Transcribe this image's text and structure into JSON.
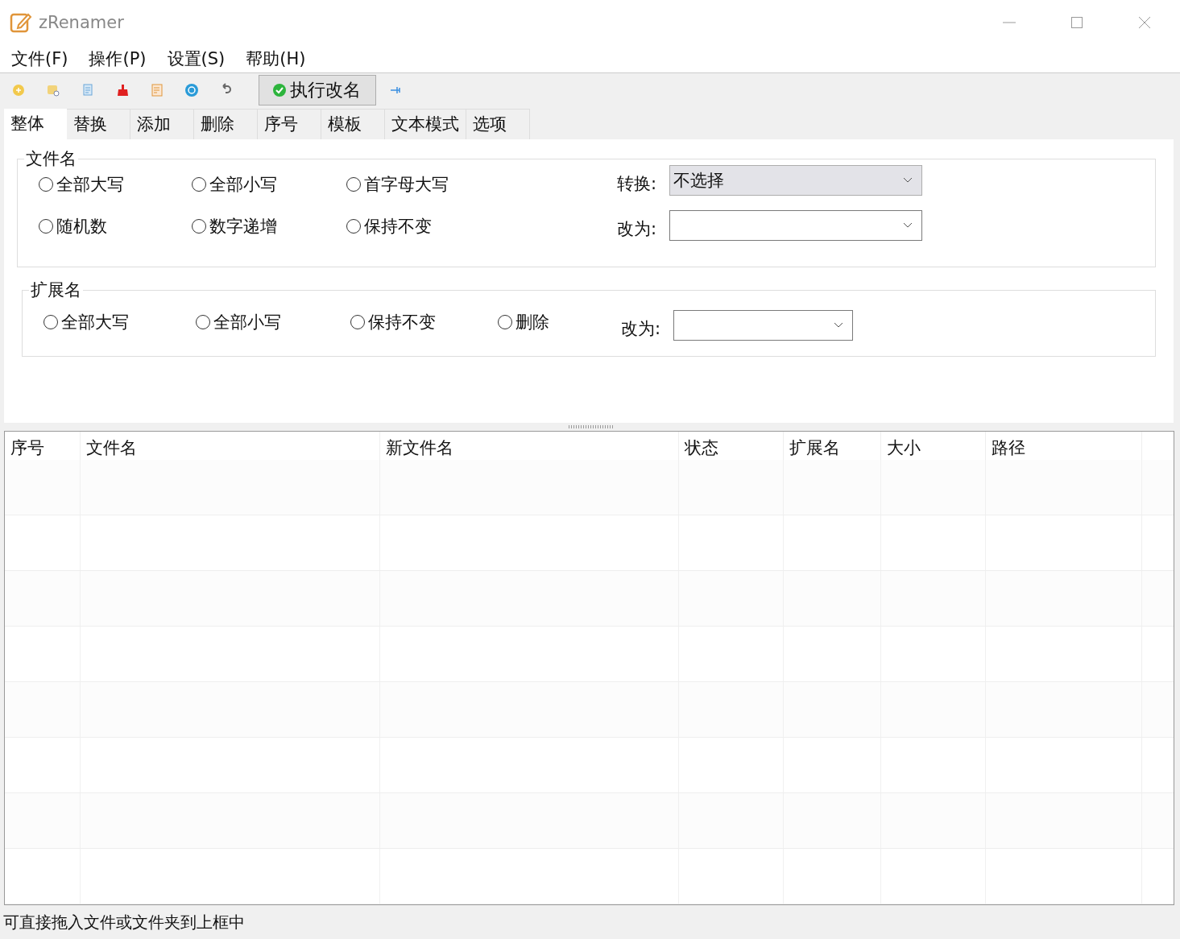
{
  "window": {
    "title": "zRenamer"
  },
  "menu": [
    "文件(F)",
    "操作(P)",
    "设置(S)",
    "帮助(H)"
  ],
  "toolbar": {
    "run_button": "执行改名"
  },
  "tabs": [
    {
      "label": "整体",
      "selected": true
    },
    {
      "label": "替换",
      "selected": false
    },
    {
      "label": "添加",
      "selected": false
    },
    {
      "label": "删除",
      "selected": false
    },
    {
      "label": "序号",
      "selected": false
    },
    {
      "label": "模板",
      "selected": false
    },
    {
      "label": "文本模式",
      "selected": false
    },
    {
      "label": "选项",
      "selected": false
    }
  ],
  "filename_group": {
    "title": "文件名",
    "options": [
      {
        "label": "全部大写",
        "selected": false
      },
      {
        "label": "全部小写",
        "selected": false
      },
      {
        "label": "首字母大写",
        "selected": false
      },
      {
        "label": "随机数",
        "selected": false
      },
      {
        "label": "数字递增",
        "selected": false
      },
      {
        "label": "保持不变",
        "selected": false
      }
    ],
    "convert": {
      "label": "转换:",
      "value": "不选择"
    },
    "change_to": {
      "label": "改为:"
    }
  },
  "extension_group": {
    "title": "扩展名",
    "options": [
      {
        "label": "全部大写",
        "selected": false
      },
      {
        "label": "全部小写",
        "selected": false
      },
      {
        "label": "保持不变",
        "selected": false
      },
      {
        "label": "删除",
        "selected": false
      }
    ],
    "change_to": {
      "label": "改为:"
    }
  },
  "table": {
    "columns": [
      "序号",
      "文件名",
      "新文件名",
      "状态",
      "扩展名",
      "大小",
      "路径"
    ]
  },
  "status_bar": "可直接拖入文件或文件夹到上框中"
}
